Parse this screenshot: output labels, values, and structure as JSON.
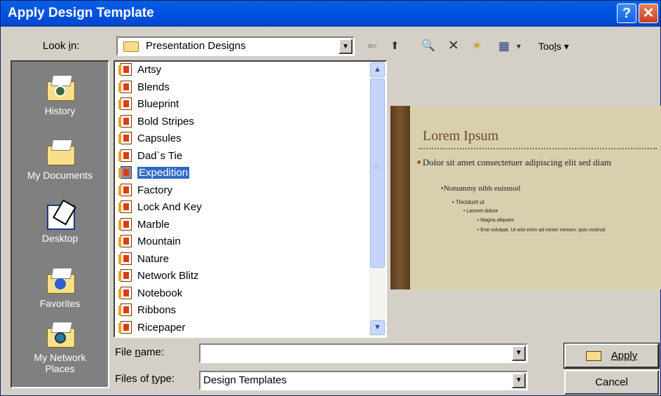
{
  "window": {
    "title": "Apply Design Template",
    "help_glyph": "?",
    "close_glyph": "✕"
  },
  "look_in": {
    "label_pre": "Look ",
    "label_u": "i",
    "label_post": "n:",
    "value": "Presentation Designs"
  },
  "toolbar": {
    "back": "⇐",
    "up": "⬆",
    "search": "🔍",
    "delete": "✕",
    "new_folder": "✶",
    "views": "▦",
    "views_arrow": "▾",
    "tools_pre": "Too",
    "tools_u": "l",
    "tools_post": "s",
    "tools_arrow": "▾"
  },
  "places": [
    {
      "label": "History"
    },
    {
      "label": "My Documents"
    },
    {
      "label": "Desktop"
    },
    {
      "label": "Favorites"
    },
    {
      "label_line1": "My Network",
      "label_line2": "Places"
    }
  ],
  "files": [
    "Artsy",
    "Blends",
    "Blueprint",
    "Bold Stripes",
    "Capsules",
    "Dad`s Tie",
    "Expedition",
    "Factory",
    "Lock And Key",
    "Marble",
    "Mountain",
    "Nature",
    "Network Blitz",
    "Notebook",
    "Ribbons",
    "Ricepaper"
  ],
  "selected_file": "Expedition",
  "preview": {
    "title": "Lorem Ipsum",
    "line1": "Dolor sit amet consectetuer adipiscing elit sed diam",
    "line2": "•Nonummy nibh euismod",
    "line3": "• Tincidunt ut",
    "line4": "• Laoreet dolore",
    "line5": "• Magna aliquam",
    "line6": "• Erat volutpat. Ut wisi enim ad minim veniam, quis nostrud"
  },
  "file_name": {
    "label_pre": "File ",
    "label_u": "n",
    "label_post": "ame:",
    "value": ""
  },
  "file_type": {
    "label_pre": "Files of ",
    "label_u": "t",
    "label_post": "ype:",
    "value": "Design Templates"
  },
  "buttons": {
    "apply": "Apply",
    "cancel": "Cancel"
  },
  "scroll": {
    "up": "▲",
    "down": "▼"
  },
  "dropdown_arrow": "▼"
}
